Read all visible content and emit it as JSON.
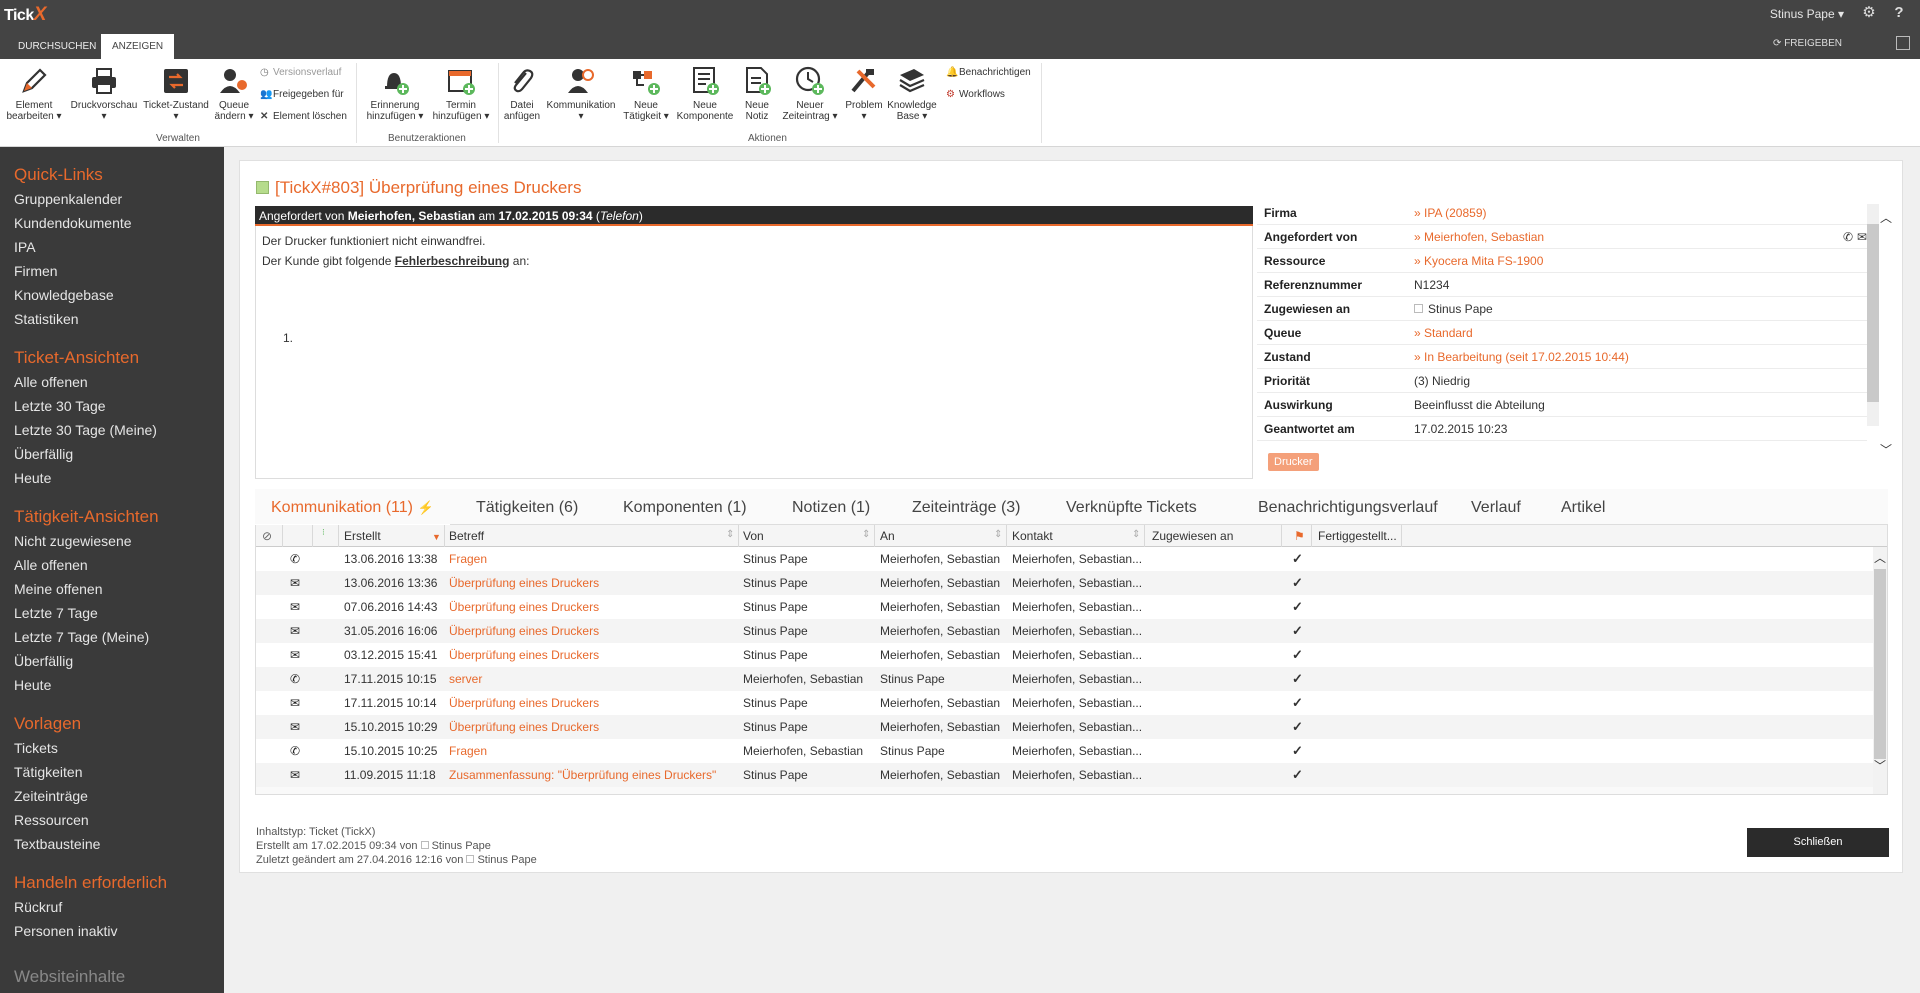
{
  "app": {
    "logo_text": "Tick",
    "logo_x": "X"
  },
  "topbar": {
    "user": "Stinus Pape ▾",
    "settings_icon": "gear-icon",
    "help_icon": "help-icon"
  },
  "ribbon_tabs": [
    {
      "label": "DURCHSUCHEN"
    },
    {
      "label": "ANZEIGEN"
    }
  ],
  "share_label": "FREIGEBEN",
  "ribbon": {
    "buttons": [
      {
        "label1": "Element",
        "label2": "bearbeiten ▾"
      },
      {
        "label1": "Druckvorschau",
        "label2": "▾"
      },
      {
        "label1": "Ticket-Zustand",
        "label2": "▾"
      },
      {
        "label1": "Queue",
        "label2": "ändern ▾"
      },
      {
        "label1": "Erinnerung",
        "label2": "hinzufügen ▾"
      },
      {
        "label1": "Termin",
        "label2": "hinzufügen ▾"
      },
      {
        "label1": "Datei",
        "label2": "anfügen"
      },
      {
        "label1": "Kommunikation",
        "label2": "▾"
      },
      {
        "label1": "Neue",
        "label2": "Tätigkeit ▾"
      },
      {
        "label1": "Neue",
        "label2": "Komponente"
      },
      {
        "label1": "Neue",
        "label2": "Notiz"
      },
      {
        "label1": "Neuer",
        "label2": "Zeiteintrag ▾"
      },
      {
        "label1": "Problem",
        "label2": "▾"
      },
      {
        "label1": "Knowledge",
        "label2": "Base ▾"
      }
    ],
    "small": [
      "Versionsverlauf",
      "Freigegeben für",
      "Element löschen",
      "Benachrichtigen",
      "Workflows"
    ],
    "groups": [
      "Verwalten",
      "Benutzeraktionen",
      "Aktionen"
    ]
  },
  "sidebar": {
    "sections": [
      {
        "title": "Quick-Links",
        "items": [
          "Gruppenkalender",
          "Kundendokumente",
          "IPA",
          "Firmen",
          "Knowledgebase",
          "Statistiken"
        ]
      },
      {
        "title": "Ticket-Ansichten",
        "items": [
          "Alle offenen",
          "Letzte 30 Tage",
          "Letzte 30 Tage (Meine)",
          "Überfällig",
          "Heute"
        ]
      },
      {
        "title": "Tätigkeit-Ansichten",
        "items": [
          "Nicht zugewiesene",
          "Alle offenen",
          "Meine offenen",
          "Letzte 7 Tage",
          "Letzte 7 Tage (Meine)",
          "Überfällig",
          "Heute"
        ]
      },
      {
        "title": "Vorlagen",
        "items": [
          "Tickets",
          "Tätigkeiten",
          "Zeiteinträge",
          "Ressourcen",
          "Textbausteine"
        ]
      },
      {
        "title": "Handeln erforderlich",
        "items": [
          "Rückruf",
          "Personen inaktiv"
        ]
      },
      {
        "title": "Websiteinhalte",
        "items": []
      }
    ]
  },
  "ticket": {
    "title": "[TickX#803] Überprüfung eines Druckers",
    "req_prefix": "Angefordert von ",
    "req_name": "Meierhofen, Sebastian",
    "req_mid": " am ",
    "req_date": "17.02.2015 09:34",
    "req_channel": "Telefon",
    "body_line1": "Der Drucker funktioniert nicht einwandfrei.",
    "body_line2_pre": "Der Kunde gibt folgende ",
    "body_line2_link": "Fehlerbeschreibung",
    "body_line2_post": " an:",
    "list_marker": "1.",
    "props": [
      {
        "k": "Firma",
        "v": "IPA (20859)",
        "link": true
      },
      {
        "k": "Angefordert von",
        "v": "Meierhofen, Sebastian",
        "link": true
      },
      {
        "k": "Ressource",
        "v": "Kyocera Mita FS-1900",
        "link": true
      },
      {
        "k": "Referenznummer",
        "v": "N1234",
        "link": false
      },
      {
        "k": "Zugewiesen an",
        "v": "Stinus Pape",
        "link": false
      },
      {
        "k": "Queue",
        "v": "Standard",
        "link": true
      },
      {
        "k": "Zustand",
        "v": "In Bearbeitung (seit 17.02.2015 10:44)",
        "link": true
      },
      {
        "k": "Priorität",
        "v": "(3) Niedrig",
        "link": false
      },
      {
        "k": "Auswirkung",
        "v": "Beeinflusst die Abteilung",
        "link": false
      },
      {
        "k": "Geantwortet am",
        "v": "17.02.2015 10:23",
        "link": false
      }
    ],
    "tag": "Drucker"
  },
  "subtabs": [
    "Kommunikation (11)",
    "Tätigkeiten (6)",
    "Komponenten (1)",
    "Notizen (1)",
    "Zeiteinträge (3)",
    "Verknüpfte Tickets",
    "Benachrichtigungsverlauf",
    "Verlauf",
    "Artikel"
  ],
  "grid": {
    "headers": [
      "Erstellt",
      "Betreff",
      "Von",
      "An",
      "Kontakt",
      "Zugewiesen an",
      "Fertiggestellt..."
    ],
    "rows": [
      {
        "type": "phone",
        "date": "13.06.2016 13:38",
        "subject": "Fragen",
        "from": "Stinus Pape",
        "to": "Meierhofen, Sebastian",
        "contact": "Meierhofen, Sebastian..."
      },
      {
        "type": "mail",
        "date": "13.06.2016 13:36",
        "subject": "Überprüfung eines Druckers",
        "from": "Stinus Pape",
        "to": "Meierhofen, Sebastian",
        "contact": "Meierhofen, Sebastian..."
      },
      {
        "type": "mail",
        "date": "07.06.2016 14:43",
        "subject": "Überprüfung eines Druckers",
        "from": "Stinus Pape",
        "to": "Meierhofen, Sebastian",
        "contact": "Meierhofen, Sebastian..."
      },
      {
        "type": "mail",
        "date": "31.05.2016 16:06",
        "subject": "Überprüfung eines Druckers",
        "from": "Stinus Pape",
        "to": "Meierhofen, Sebastian",
        "contact": "Meierhofen, Sebastian..."
      },
      {
        "type": "mail",
        "date": "03.12.2015 15:41",
        "subject": "Überprüfung eines Druckers",
        "from": "Stinus Pape",
        "to": "Meierhofen, Sebastian",
        "contact": "Meierhofen, Sebastian..."
      },
      {
        "type": "phone",
        "date": "17.11.2015 10:15",
        "subject": "server",
        "from": "Meierhofen, Sebastian",
        "to": "Stinus Pape",
        "contact": "Meierhofen, Sebastian..."
      },
      {
        "type": "mail",
        "date": "17.11.2015 10:14",
        "subject": "Überprüfung eines Druckers",
        "from": "Stinus Pape",
        "to": "Meierhofen, Sebastian",
        "contact": "Meierhofen, Sebastian..."
      },
      {
        "type": "mail",
        "date": "15.10.2015 10:29",
        "subject": "Überprüfung eines Druckers",
        "from": "Stinus Pape",
        "to": "Meierhofen, Sebastian",
        "contact": "Meierhofen, Sebastian..."
      },
      {
        "type": "phone",
        "date": "15.10.2015 10:25",
        "subject": "Fragen",
        "from": "Meierhofen, Sebastian",
        "to": "Stinus Pape",
        "contact": "Meierhofen, Sebastian..."
      },
      {
        "type": "summary",
        "date": "11.09.2015 11:18",
        "subject": "Zusammenfassung: \"Überprüfung eines Druckers\"",
        "from": "Stinus Pape",
        "to": "Meierhofen, Sebastian",
        "contact": "Meierhofen, Sebastian..."
      }
    ]
  },
  "footer": {
    "line1": "Inhaltstyp: Ticket (TickX)",
    "line2_pre": "Erstellt am 17.02.2015 09:34 von",
    "line2_user": "Stinus Pape",
    "line3_pre": "Zuletzt geändert am 27.04.2016 12:16 von",
    "line3_user": "Stinus Pape",
    "close_label": "Schließen"
  },
  "colors": {
    "accent": "#e8692c",
    "dark": "#3a3a3a",
    "topbar": "#444444"
  }
}
